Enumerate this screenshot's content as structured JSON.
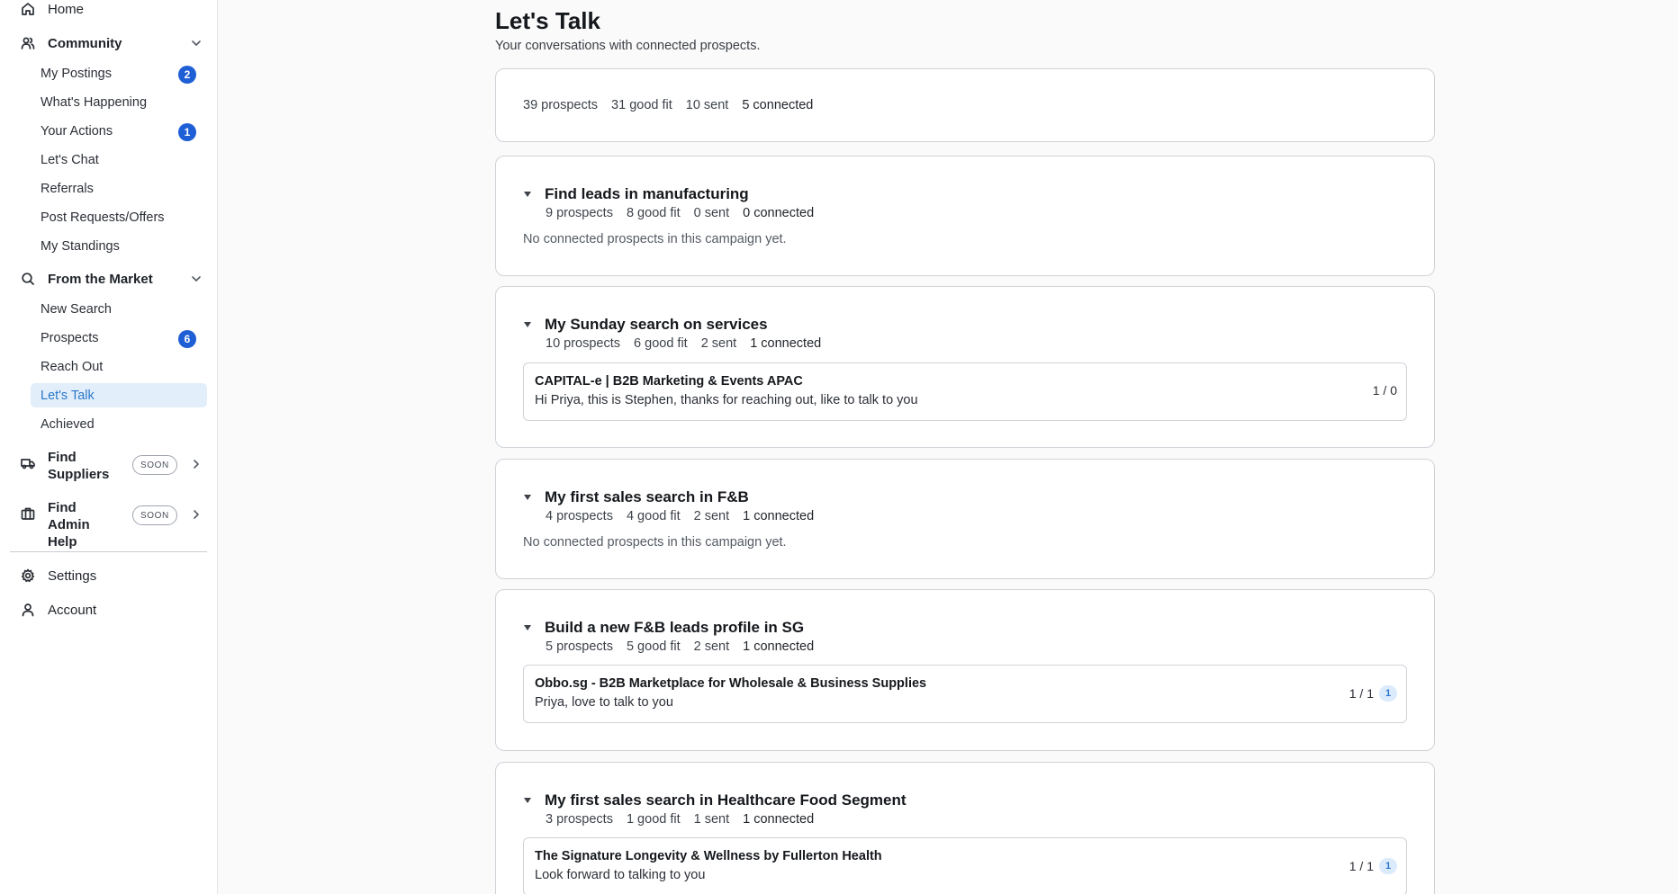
{
  "sidebar": {
    "home": "Home",
    "community": {
      "label": "Community",
      "items": [
        {
          "label": "My Postings",
          "badge": "2"
        },
        {
          "label": "What's Happening",
          "badge": null
        },
        {
          "label": "Your Actions",
          "badge": "1"
        },
        {
          "label": "Let's Chat",
          "badge": null
        },
        {
          "label": "Referrals",
          "badge": null
        },
        {
          "label": "Post Requests/Offers",
          "badge": null
        },
        {
          "label": "My Standings",
          "badge": null
        }
      ]
    },
    "market": {
      "label": "From the Market",
      "items": [
        {
          "label": "New Search",
          "badge": null
        },
        {
          "label": "Prospects",
          "badge": "6"
        },
        {
          "label": "Reach Out",
          "badge": null
        },
        {
          "label": "Let's Talk",
          "badge": null,
          "active": true
        },
        {
          "label": "Achieved",
          "badge": null
        }
      ]
    },
    "find_suppliers": {
      "line1": "Find",
      "line2": "Suppliers",
      "pill": "SOON"
    },
    "find_admin": {
      "line1": "Find Admin",
      "line2": "Help",
      "pill": "SOON"
    },
    "settings": "Settings",
    "account": "Account"
  },
  "page": {
    "title": "Let's Talk",
    "subtitle": "Your conversations with connected prospects."
  },
  "summary": {
    "prospects": "39 prospects",
    "good_fit": "31 good fit",
    "sent": "10 sent",
    "connected": "5 connected"
  },
  "campaigns": [
    {
      "title": "Find leads in manufacturing",
      "prospects": "9 prospects",
      "good_fit": "8 good fit",
      "sent": "0 sent",
      "connected": "0 connected",
      "empty_text": "No connected prospects in this campaign yet."
    },
    {
      "title": "My Sunday search on services",
      "prospects": "10 prospects",
      "good_fit": "6 good fit",
      "sent": "2 sent",
      "connected": "1 connected",
      "conversation": {
        "name": "CAPITAL-e | B2B Marketing & Events APAC",
        "message": "Hi Priya, this is Stephen, thanks for reaching out, like to talk to you",
        "count": "1 / 0",
        "unread": null
      }
    },
    {
      "title": "My first sales search in F&B",
      "prospects": "4 prospects",
      "good_fit": "4 good fit",
      "sent": "2 sent",
      "connected": "1 connected",
      "empty_text": "No connected prospects in this campaign yet."
    },
    {
      "title": "Build a new F&B leads profile in SG",
      "prospects": "5 prospects",
      "good_fit": "5 good fit",
      "sent": "2 sent",
      "connected": "1 connected",
      "conversation": {
        "name": "Obbo.sg - B2B Marketplace for Wholesale & Business Supplies",
        "message": "Priya, love to talk to you",
        "count": "1 / 1",
        "unread": "1"
      }
    },
    {
      "title": "My first sales search in Healthcare Food Segment",
      "prospects": "3 prospects",
      "good_fit": "1 good fit",
      "sent": "1 sent",
      "connected": "1 connected",
      "conversation": {
        "name": "The Signature Longevity & Wellness by Fullerton Health",
        "message": "Look forward to talking to you",
        "count": "1 / 1",
        "unread": "1"
      }
    }
  ]
}
